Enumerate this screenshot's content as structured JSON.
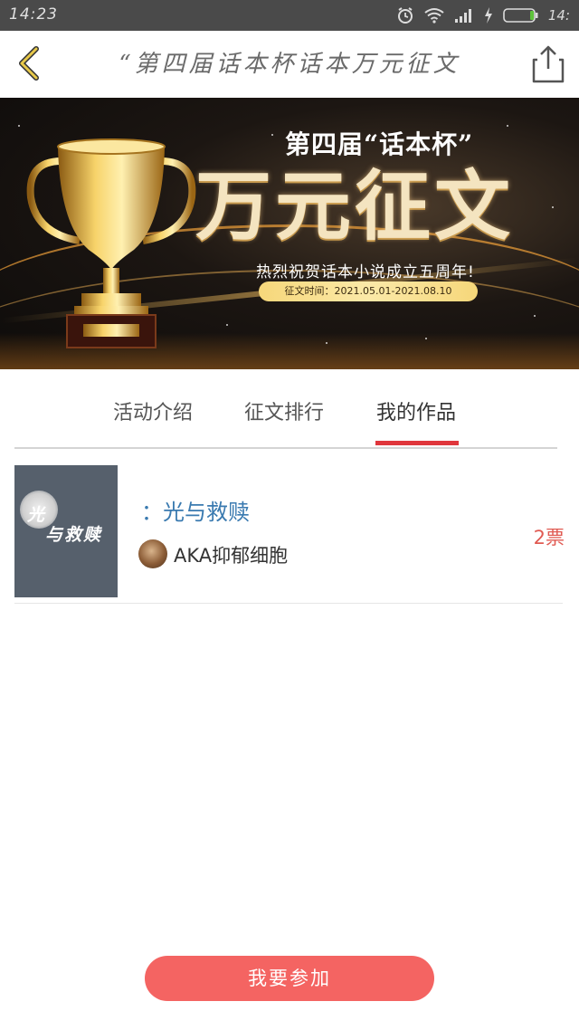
{
  "status_bar": {
    "time": "14:23",
    "battery_text": "14:"
  },
  "header": {
    "title": "“第四届话本杯话本万元征文"
  },
  "banner": {
    "subtitle": "第四届“话本杯”",
    "main_title": "万元征文",
    "tagline": "热烈祝贺话本小说成立五周年!",
    "date_range": "征文时间：2021.05.01-2021.08.10"
  },
  "tabs": [
    {
      "label": "活动介绍"
    },
    {
      "label": "征文排行"
    },
    {
      "label": "我的作品"
    }
  ],
  "active_tab": "我的作品",
  "entries": [
    {
      "cover_text_1": "光",
      "cover_text_2": "与救赎",
      "title": "：光与救赎",
      "author": "AKA抑郁细胞",
      "votes": "2票"
    }
  ],
  "join_button": "我要参加",
  "colors": {
    "accent_red": "#e0363c",
    "button": "#f46462",
    "title_blue": "#3a7ab0",
    "votes_red": "#e05a52"
  }
}
